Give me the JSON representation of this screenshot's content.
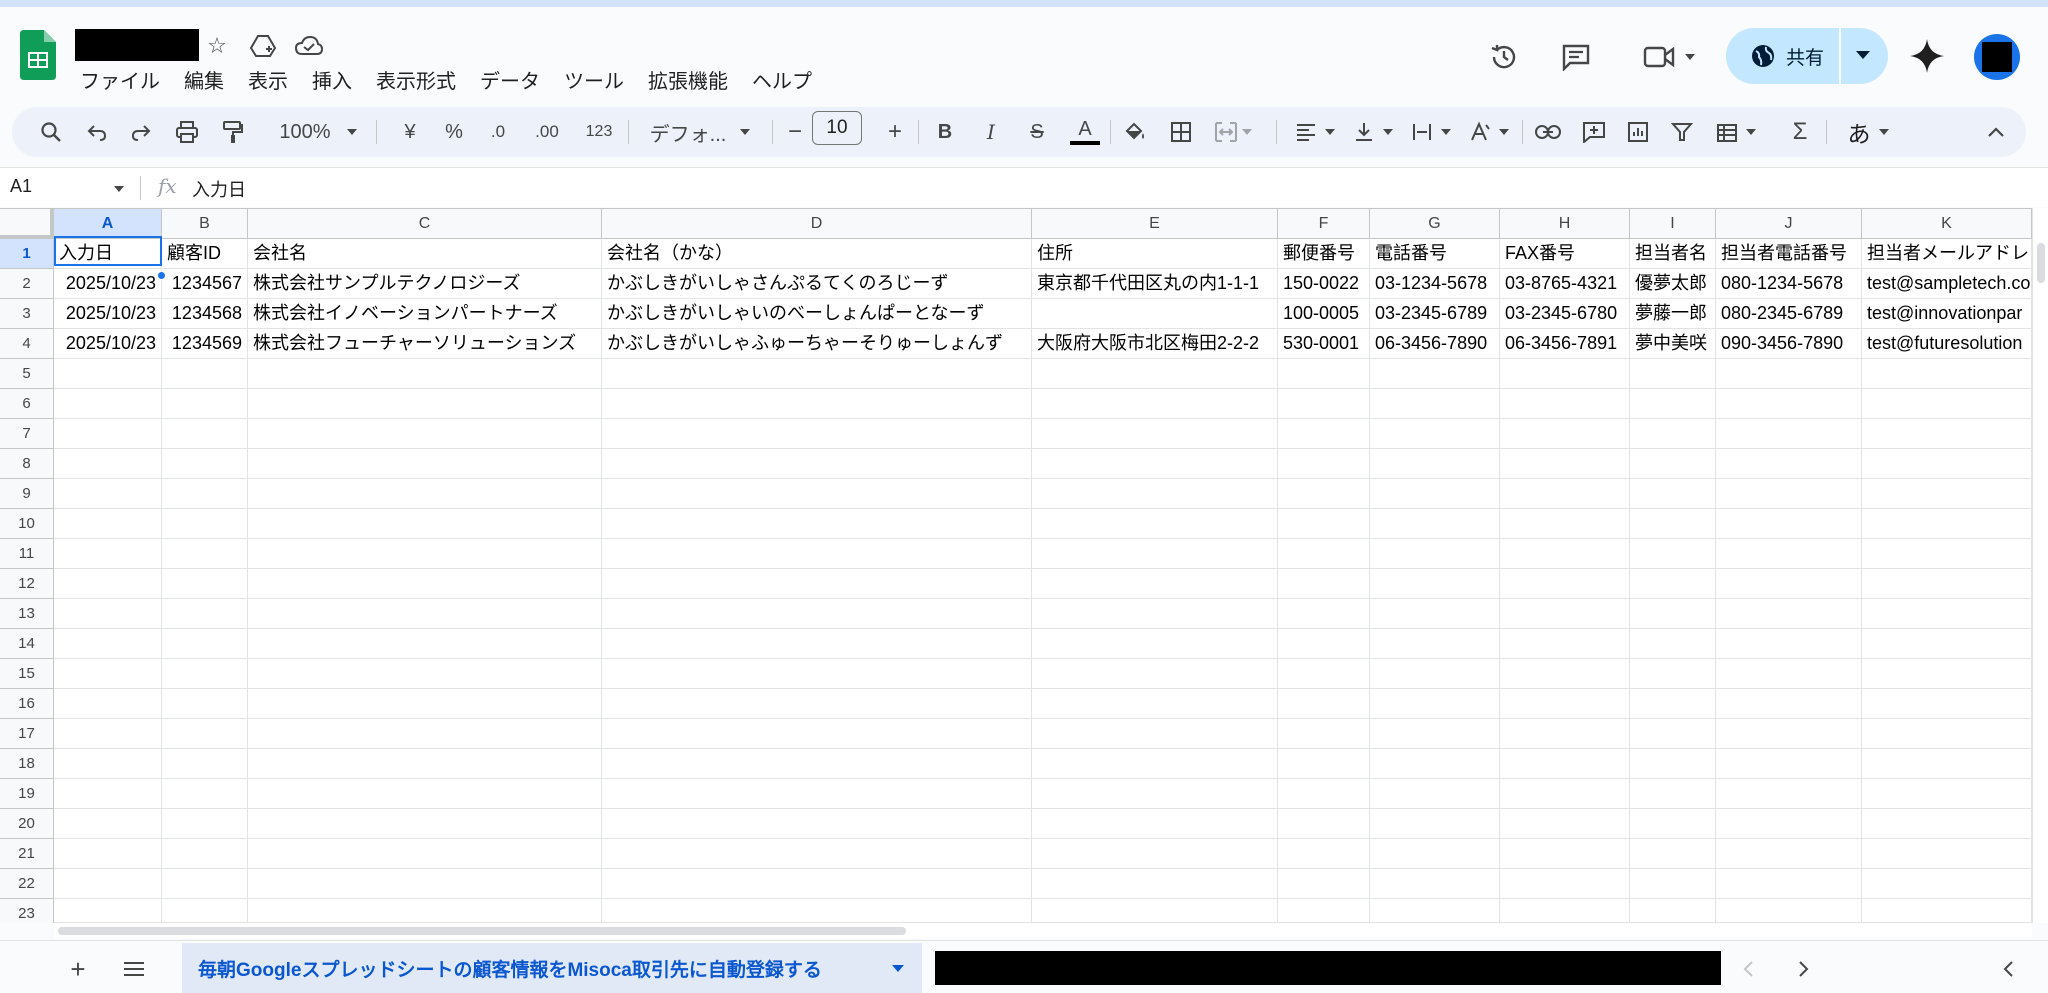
{
  "app": {
    "menu": [
      "ファイル",
      "編集",
      "表示",
      "挿入",
      "表示形式",
      "データ",
      "ツール",
      "拡張機能",
      "ヘルプ"
    ],
    "share_label": "共有"
  },
  "toolbar": {
    "zoom": "100%",
    "currency": "¥",
    "percent": "%",
    "decimal_decrease": ".0",
    "decimal_increase": ".00",
    "number_format": "123",
    "font": "デフォ...",
    "font_size": "10",
    "input_tool": "あ"
  },
  "formula_bar": {
    "name_box": "A1",
    "fx": "fx",
    "value": "入力日"
  },
  "sheet": {
    "columns": [
      "A",
      "B",
      "C",
      "D",
      "E",
      "F",
      "G",
      "H",
      "I",
      "J",
      "K"
    ],
    "row_numbers": [
      "1",
      "2",
      "3",
      "4",
      "5",
      "6",
      "7",
      "8",
      "9",
      "10",
      "11",
      "12",
      "13",
      "14",
      "15",
      "16",
      "17",
      "18",
      "19",
      "20",
      "21",
      "22",
      "23"
    ],
    "rows": [
      [
        "入力日",
        "顧客ID",
        "会社名",
        "会社名（かな）",
        "住所",
        "郵便番号",
        "電話番号",
        "FAX番号",
        "担当者名",
        "担当者電話番号",
        "担当者メールアドレ"
      ],
      [
        "2025/10/23",
        "1234567",
        "株式会社サンプルテクノロジーズ",
        "かぶしきがいしゃさんぷるてくのろじーず",
        "東京都千代田区丸の内1-1-1",
        "150-0022",
        "03-1234-5678",
        "03-8765-4321",
        "優夢太郎",
        "080-1234-5678",
        "test@sampletech.co"
      ],
      [
        "2025/10/23",
        "1234568",
        "株式会社イノベーションパートナーズ",
        "かぶしきがいしゃいのべーしょんぱーとなーず",
        "",
        "100-0005",
        "03-2345-6789",
        "03-2345-6780",
        "夢藤一郎",
        "080-2345-6789",
        "test@innovationpar"
      ],
      [
        "2025/10/23",
        "1234569",
        "株式会社フューチャーソリューションズ",
        "かぶしきがいしゃふゅーちゃーそりゅーしょんず",
        "大阪府大阪市北区梅田2-2-2",
        "530-0001",
        "06-3456-7890",
        "06-3456-7891",
        "夢中美咲",
        "090-3456-7890",
        "test@futuresolution"
      ]
    ]
  },
  "sheet_tabs": {
    "active": "毎朝Googleスプレッドシートの顧客情報をMisoca取引先に自動登録する"
  }
}
